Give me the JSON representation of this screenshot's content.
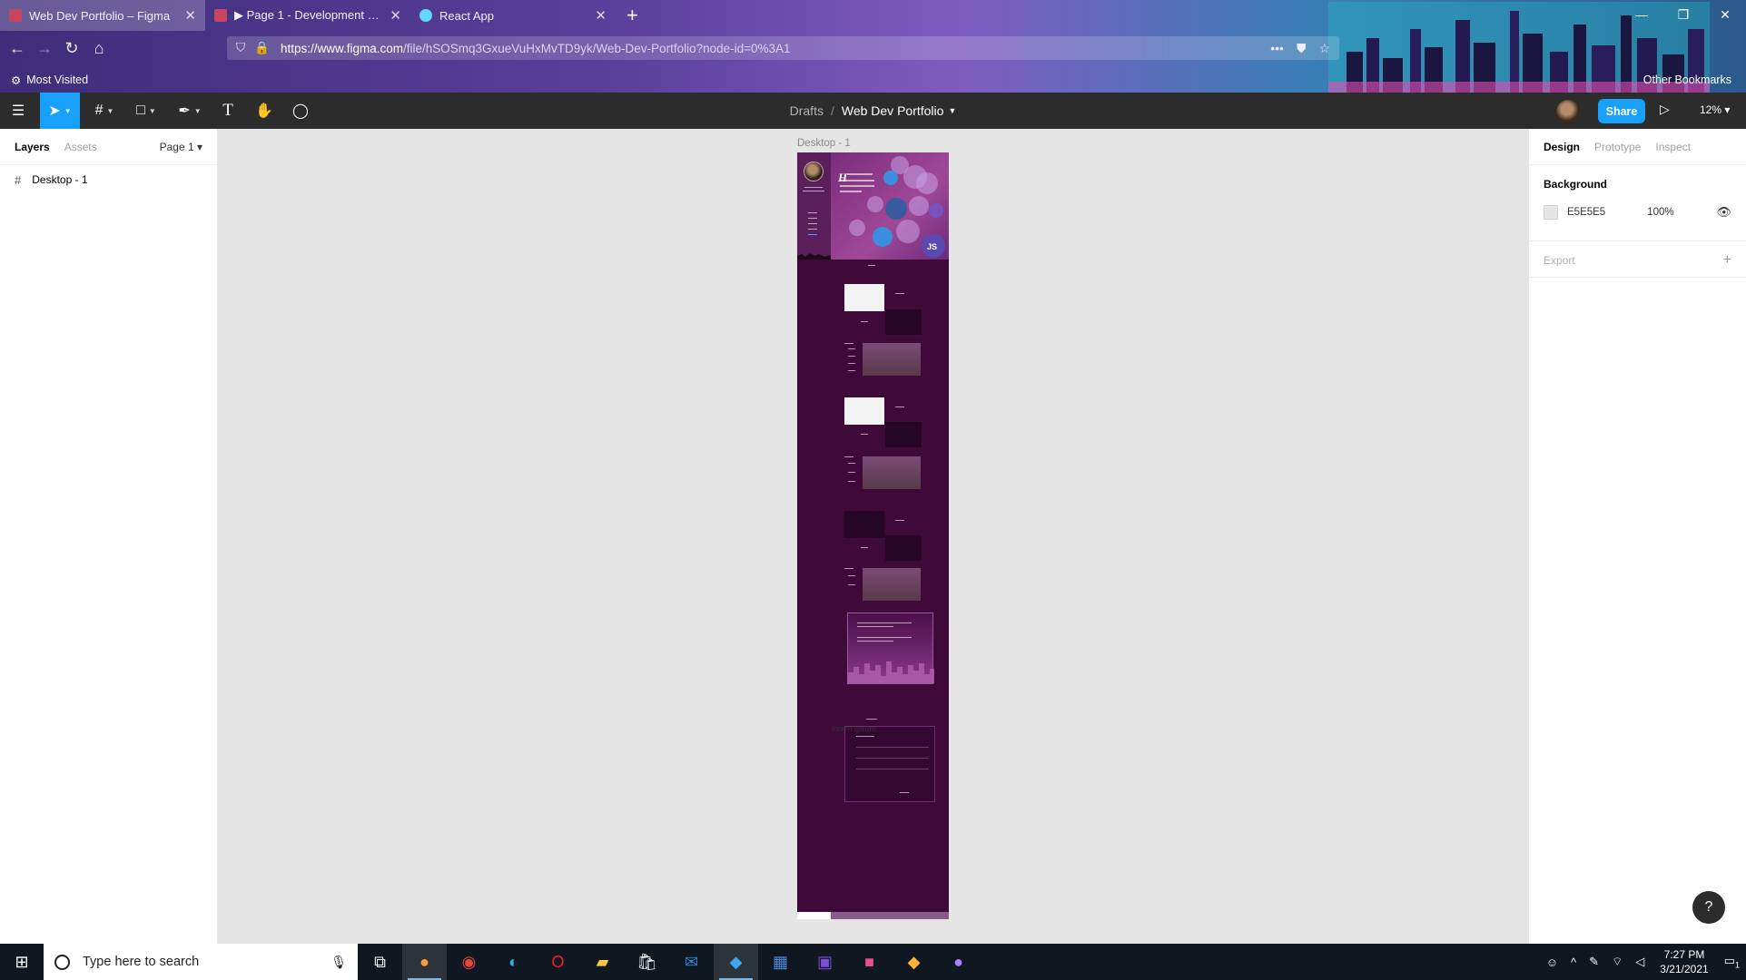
{
  "browser": {
    "tabs": [
      {
        "title": "Web Dev Portfolio – Figma",
        "active": true,
        "fav_color": "#c5465e"
      },
      {
        "title": "▶ Page 1 - Development Portfo",
        "active": false,
        "fav_color": "#c5465e"
      },
      {
        "title": "React App",
        "active": false,
        "fav_color": "#61dafb"
      }
    ],
    "new_tab": "+",
    "url_host": "https://www.figma.com",
    "url_rest": "/file/hSOSmq3GxueVuHxMvTD9yk/Web-Dev-Portfolio?node-id=0%3A1",
    "bookmarks": {
      "most_visited": "Most Visited",
      "other": "Other Bookmarks"
    }
  },
  "figma": {
    "breadcrumb_drafts": "Drafts",
    "file_name": "Web Dev Portfolio",
    "share_label": "Share",
    "zoom": "12%",
    "left_panel": {
      "tab_layers": "Layers",
      "tab_assets": "Assets",
      "page_selector": "Page 1",
      "layers": [
        {
          "name": "Desktop - 1"
        }
      ]
    },
    "right_panel": {
      "tabs": [
        "Design",
        "Prototype",
        "Inspect"
      ],
      "background_title": "Background",
      "bg_hex": "E5E5E5",
      "bg_opacity": "100%",
      "export_title": "Export"
    },
    "canvas": {
      "frame_label": "Desktop - 1",
      "hero_letter": "H",
      "js_label": "JS",
      "sticky_note": "lorem ipsum"
    },
    "help": "?"
  },
  "taskbar": {
    "search_placeholder": "Type here to search",
    "time": "7:27 PM",
    "date": "3/21/2021",
    "notification_count": "1"
  }
}
